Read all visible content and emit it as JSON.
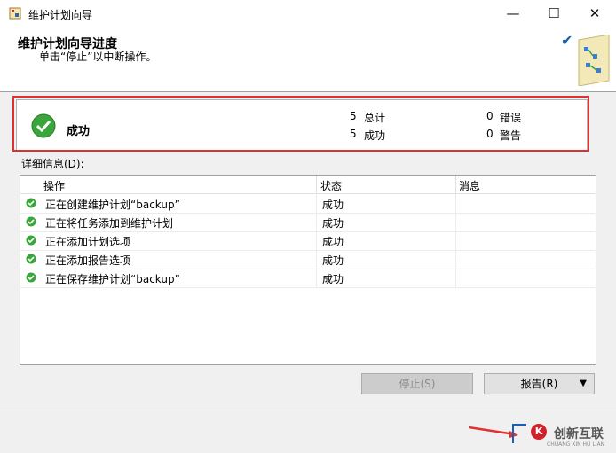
{
  "window": {
    "title": "维护计划向导",
    "minimize": "—",
    "maximize": "☐",
    "close": "✕"
  },
  "header": {
    "title": "维护计划向导进度",
    "subtitle": "单击“停止”以中断操作。"
  },
  "summary": {
    "status": "成功",
    "total_count": "5",
    "total_label": "总计",
    "success_count": "5",
    "success_label": "成功",
    "error_count": "0",
    "error_label": "错误",
    "warning_count": "0",
    "warning_label": "警告"
  },
  "details": {
    "label": "详细信息(D):",
    "columns": [
      "操作",
      "状态",
      "消息"
    ],
    "rows": [
      {
        "op": "正在创建维护计划“backup”",
        "status": "成功",
        "msg": ""
      },
      {
        "op": "正在将任务添加到维护计划",
        "status": "成功",
        "msg": ""
      },
      {
        "op": "正在添加计划选项",
        "status": "成功",
        "msg": ""
      },
      {
        "op": "正在添加报告选项",
        "status": "成功",
        "msg": ""
      },
      {
        "op": "正在保存维护计划“backup”",
        "status": "成功",
        "msg": ""
      }
    ]
  },
  "buttons": {
    "stop": "停止(S)",
    "report": "报告(R)",
    "report_arrow": "▼"
  },
  "watermark": {
    "logo": "K",
    "text": "创新互联",
    "sub": "CHUANG XIN HU LIAN"
  },
  "colors": {
    "success_green": "#2e9e2e",
    "highlight_red": "#e03030"
  }
}
